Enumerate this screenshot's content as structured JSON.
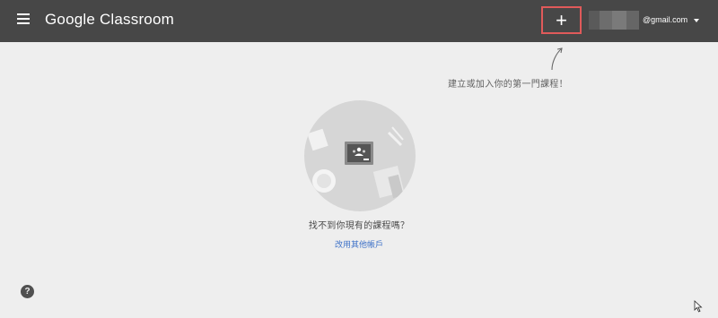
{
  "header": {
    "app_name": "Google Classroom",
    "add_button_label": "+",
    "account_email": "@gmail.com",
    "add_button_highlight_color": "#e05a5a"
  },
  "hint": {
    "text": "建立或加入你的第一門課程！"
  },
  "empty_state": {
    "message": "找不到你現有的課程嗎？",
    "switch_account_link": "改用其他帳戶"
  },
  "footer": {
    "help_label": "?"
  },
  "colors": {
    "topbar": "#474747",
    "background": "#eeeeee",
    "link": "#3f72c8"
  },
  "icons": [
    "menu-icon",
    "plus-icon",
    "caret-down-icon",
    "hint-arrow-icon",
    "classroom-illustration",
    "help-icon",
    "mouse-cursor-icon"
  ]
}
